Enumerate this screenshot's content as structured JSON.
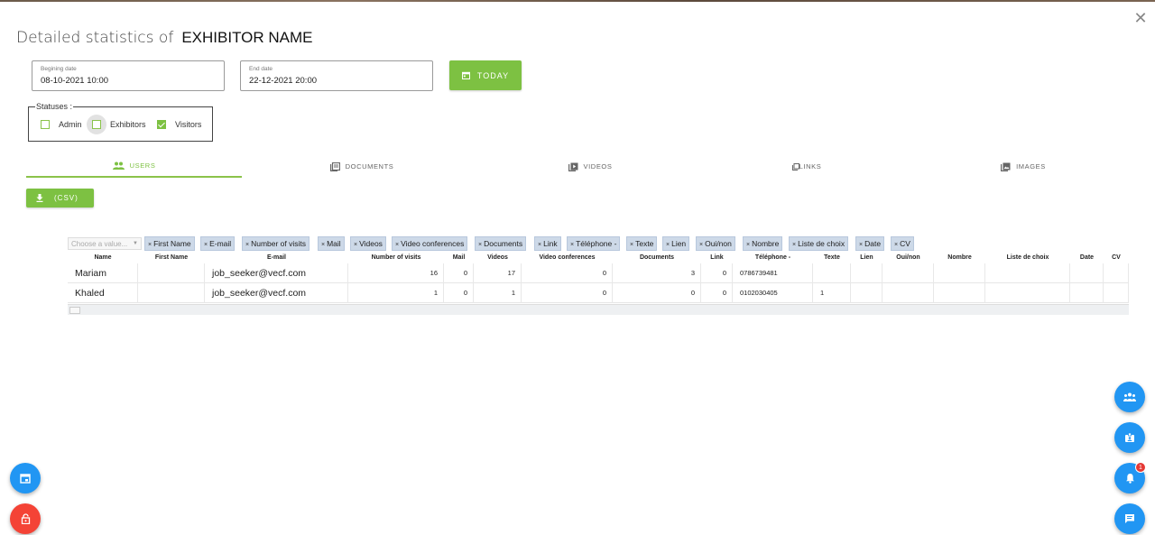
{
  "modal": {
    "title_prefix": "Detailed statistics of",
    "exhibitor_name": "EXHIBITOR NAME",
    "close_symbol": "✕"
  },
  "dates": {
    "begin_label": "Begining date",
    "begin_value": "08-10-2021 10:00",
    "end_label": "End date",
    "end_value": "22-12-2021 20:00",
    "today_label": "TODAY"
  },
  "statuses": {
    "legend": "Statuses :",
    "options": [
      {
        "label": "Admin",
        "checked": false
      },
      {
        "label": "Exhibitors",
        "checked": false
      },
      {
        "label": "Visitors",
        "checked": true
      }
    ]
  },
  "tabs": [
    {
      "label": "USERS",
      "icon": "people-icon",
      "active": true
    },
    {
      "label": "DOCUMENTS",
      "icon": "library-icon",
      "active": false
    },
    {
      "label": "VIDEOS",
      "icon": "video-library-icon",
      "active": false
    },
    {
      "label": "LINKS",
      "icon": "links-icon",
      "active": false
    },
    {
      "label": "IMAGES",
      "icon": "photo-library-icon",
      "active": false
    }
  ],
  "export": {
    "label": "(CSV)",
    "icon": "download-icon"
  },
  "filter": {
    "placeholder": "Choose a value...",
    "chips": [
      "First Name",
      "E-mail",
      "Number of visits",
      "Mail",
      "Videos",
      "Video conferences",
      "Documents",
      "Link",
      "Téléphone -",
      "Texte",
      "Lien",
      "Oui/non",
      "Nombre",
      "Liste de choix",
      "Date",
      "CV"
    ]
  },
  "table": {
    "columns": [
      "Name",
      "First Name",
      "E-mail",
      "Number of visits",
      "Mail",
      "Videos",
      "Video conferences",
      "Documents",
      "Link",
      "Téléphone -",
      "Texte",
      "Lien",
      "Oui/non",
      "Nombre",
      "Liste de choix",
      "Date",
      "CV"
    ],
    "rows": [
      [
        "Mariam",
        "",
        "job_seeker@vecf.com",
        "16",
        "0",
        "17",
        "0",
        "3",
        "0",
        "0786739481",
        "",
        "",
        "",
        "",
        "",
        "",
        ""
      ],
      [
        "Khaled",
        "",
        "job_seeker@vecf.com",
        "1",
        "0",
        "1",
        "0",
        "0",
        "0",
        "0102030405",
        "1",
        "",
        "",
        "",
        "",
        "",
        ""
      ]
    ]
  },
  "fabs": {
    "calendar": "calendar-icon",
    "lock": "lock-icon",
    "users": "group-icon",
    "badge_person": "badge-icon",
    "notifications": "bell-icon",
    "notification_count": "1",
    "chat": "chat-icon",
    "colors": {
      "blue": "#2196f3",
      "red": "#f44336",
      "green": "#7dc142"
    }
  }
}
